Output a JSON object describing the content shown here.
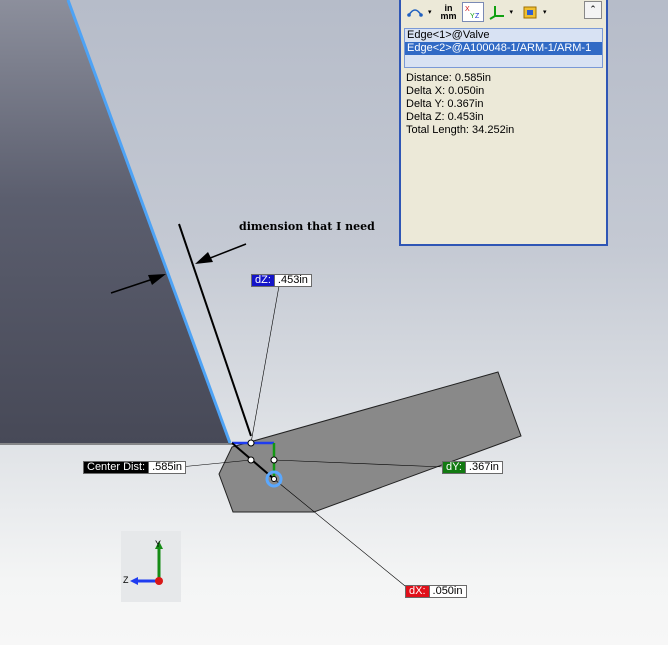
{
  "toolbar": {
    "units_top": "in",
    "units_bottom": "mm",
    "dropdown_glyph": "▾",
    "collapse_glyph": "⌃",
    "icons": [
      "measure-arc-icon",
      "units-icon",
      "xyz-delta-icon",
      "coordinate-system-icon",
      "projection-icon",
      "collapse-icon"
    ]
  },
  "selections": [
    {
      "label": "Edge<1>@Valve",
      "selected": false
    },
    {
      "label": "Edge<2>@A100048-1/ARM-1/ARM-1",
      "selected": true
    }
  ],
  "results": [
    "Distance: 0.585in",
    "Delta X: 0.050in",
    "Delta Y: 0.367in",
    "Delta Z: 0.453in",
    "Total Length: 34.252in"
  ],
  "callouts": {
    "dz": {
      "key": "dZ:",
      "value": ".453in",
      "color": "#1414c8"
    },
    "center": {
      "key": "Center Dist:",
      "value": ".585in",
      "color": "#000000"
    },
    "dy": {
      "key": "dY:",
      "value": ".367in",
      "color": "#127a12"
    },
    "dx": {
      "key": "dX:",
      "value": ".050in",
      "color": "#e0101a"
    }
  },
  "annotation": "dimension that I need",
  "triad": {
    "y": "Y",
    "z": "Z"
  },
  "colors": {
    "highlight_edge": "#4ea3f5",
    "panel_border": "#2f56b5",
    "selection": "#316ac5"
  }
}
